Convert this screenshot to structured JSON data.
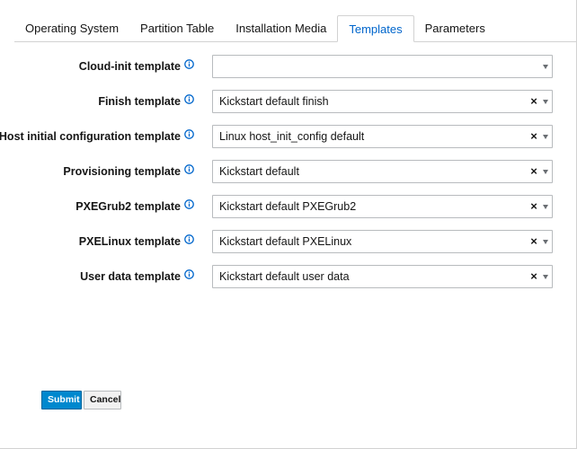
{
  "tabs": [
    {
      "label": "Operating System"
    },
    {
      "label": "Partition Table"
    },
    {
      "label": "Installation Media"
    },
    {
      "label": "Templates"
    },
    {
      "label": "Parameters"
    }
  ],
  "active_tab": "Templates",
  "fields": [
    {
      "label": "Cloud-init template",
      "value": "",
      "clearable": false,
      "icon": "info-circle-icon"
    },
    {
      "label": "Finish template",
      "value": "Kickstart default finish",
      "clearable": true,
      "icon": "info-circle-icon"
    },
    {
      "label": "Host initial configuration template",
      "value": "Linux host_init_config default",
      "clearable": true,
      "icon": "info-circle-icon"
    },
    {
      "label": "Provisioning template",
      "value": "Kickstart default",
      "clearable": true,
      "icon": "info-circle-icon"
    },
    {
      "label": "PXEGrub2 template",
      "value": "Kickstart default PXEGrub2",
      "clearable": true,
      "icon": "info-circle-icon"
    },
    {
      "label": "PXELinux template",
      "value": "Kickstart default PXELinux",
      "clearable": true,
      "icon": "info-circle-icon"
    },
    {
      "label": "User data template",
      "value": "Kickstart default user data",
      "clearable": true,
      "icon": "info-circle-icon"
    }
  ],
  "clear_glyph": "×",
  "actions": {
    "submit_label": "Submit",
    "cancel_label": "Cancel"
  },
  "colors": {
    "accent": "#0066cc",
    "primary_button": "#0088ce",
    "info_icon": "#0066cc"
  }
}
